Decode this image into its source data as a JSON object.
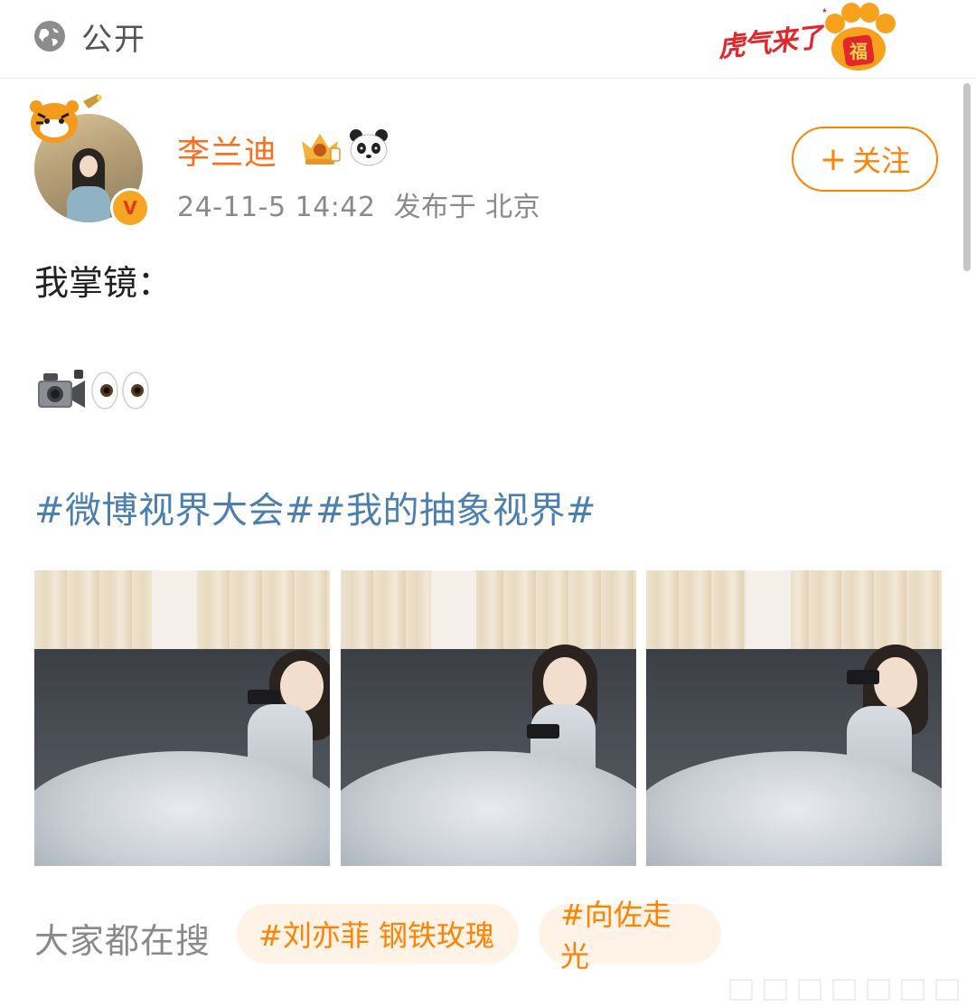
{
  "topbar": {
    "visibility_label": "公开",
    "badge_text": "虎气来了",
    "badge_icon": "tiger-paw-fu-icon"
  },
  "post": {
    "author": {
      "name": "李兰迪",
      "verified_icon": "verified-v-icon",
      "badges": [
        "crown-badge-icon",
        "panda-badge-icon"
      ]
    },
    "meta": "24-11-5 14:42  发布于 北京",
    "follow_label": "关注",
    "text_line": "我掌镜：",
    "emojis": [
      "video-camera-icon",
      "eyes-icon"
    ],
    "hashtags": "#微博视界大会##我的抽象视界#",
    "photos": [
      "photo-1",
      "photo-2",
      "photo-3"
    ]
  },
  "trending": {
    "label": "大家都在搜",
    "chips": [
      "#刘亦菲 钢铁玫瑰",
      "#向佐走光"
    ]
  },
  "colors": {
    "accent": "#ff8200",
    "username": "#ff6d18",
    "hashtag": "#4a7fb0",
    "meta": "#8a8a8a",
    "chip_bg": "#fff3e8"
  }
}
